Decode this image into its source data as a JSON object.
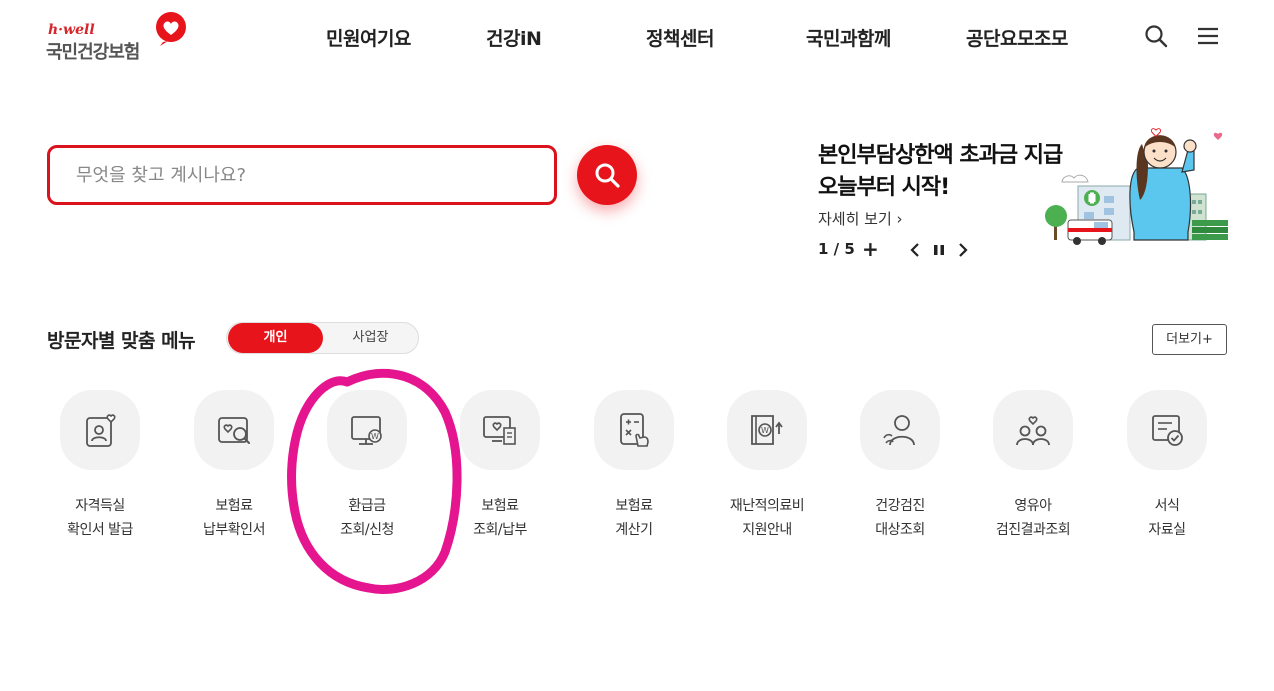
{
  "header": {
    "logo_sub": "h·well",
    "logo_main": "국민건강보험",
    "nav": [
      "민원여기요",
      "건강iN",
      "정책센터",
      "국민과함께",
      "공단요모조모"
    ]
  },
  "search": {
    "placeholder": "무엇을 찾고 계시나요?"
  },
  "banner": {
    "title_line1": "본인부담상한액 초과금 지급",
    "title_line2": "오늘부터 시작!",
    "more": "자세히 보기 ›",
    "pager": "1 / 5",
    "plus": "+"
  },
  "menu": {
    "title": "방문자별 맞춤 메뉴",
    "toggle_active": "개인",
    "toggle_inactive": "사업장",
    "more": "더보기+",
    "items": [
      {
        "line1": "자격득실",
        "line2": "확인서 발급"
      },
      {
        "line1": "보험료",
        "line2": "납부확인서"
      },
      {
        "line1": "환급금",
        "line2": "조회/신청"
      },
      {
        "line1": "보험료",
        "line2": "조회/납부"
      },
      {
        "line1": "보험료",
        "line2": "계산기"
      },
      {
        "line1": "재난적의료비",
        "line2": "지원안내"
      },
      {
        "line1": "건강검진",
        "line2": "대상조회"
      },
      {
        "line1": "영유아",
        "line2": "검진결과조회"
      },
      {
        "line1": "서식",
        "line2": "자료실"
      }
    ]
  },
  "colors": {
    "brand_red": "#e8141c",
    "annotation_magenta": "#e5148f"
  }
}
